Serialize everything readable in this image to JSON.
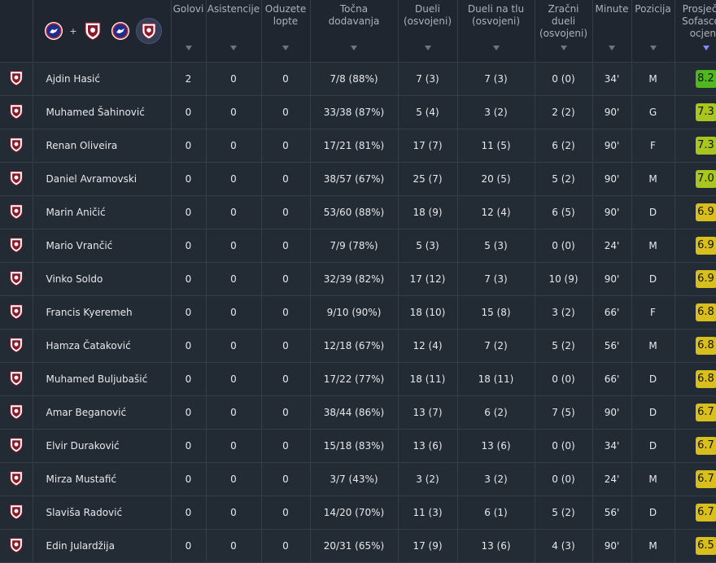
{
  "headers": {
    "goals": [
      "Golovi"
    ],
    "assists": [
      "Asistencije"
    ],
    "tackles": [
      "Oduzete",
      "lopte"
    ],
    "passes": [
      "Točna",
      "dodavanja"
    ],
    "duels": [
      "Dueli",
      "(osvojeni)"
    ],
    "ground": [
      "Dueli na tlu",
      "(osvojeni)"
    ],
    "aerial": [
      "Zračni",
      "dueli",
      "(osvojeni)"
    ],
    "minutes": [
      "Minute"
    ],
    "position": [
      "Pozicija"
    ],
    "rating": [
      "Prosječna",
      "Sofascore",
      "ocjena"
    ]
  },
  "icons": {
    "team_a": "team-a-crest-icon",
    "team_b": "team-b-crest-icon",
    "plus": "+",
    "player_shield": "club-shield-icon"
  },
  "colors": {
    "bg": "#1e252e",
    "row": "#232b34",
    "border": "#343d48",
    "rating_green": "#4fb81e",
    "rating_lime": "#a9c51f",
    "rating_yellow": "#d9bf1e",
    "sort_active": "#7f8cff"
  },
  "players": [
    {
      "name": "Ajdin Hasić",
      "goals": "2",
      "assists": "0",
      "tackles": "0",
      "passes": "7/8 (88%)",
      "duels": "7 (3)",
      "ground": "7 (3)",
      "aerial": "0 (0)",
      "minutes": "34'",
      "position": "M",
      "rating": "8.2",
      "rating_color": "#4fb81e"
    },
    {
      "name": "Muhamed Šahinović",
      "goals": "0",
      "assists": "0",
      "tackles": "0",
      "passes": "33/38 (87%)",
      "duels": "5 (4)",
      "ground": "3 (2)",
      "aerial": "2 (2)",
      "minutes": "90'",
      "position": "G",
      "rating": "7.3",
      "rating_color": "#a9c51f"
    },
    {
      "name": "Renan Oliveira",
      "goals": "0",
      "assists": "0",
      "tackles": "0",
      "passes": "17/21 (81%)",
      "duels": "17 (7)",
      "ground": "11 (5)",
      "aerial": "6 (2)",
      "minutes": "90'",
      "position": "F",
      "rating": "7.3",
      "rating_color": "#a9c51f"
    },
    {
      "name": "Daniel Avramovski",
      "goals": "0",
      "assists": "0",
      "tackles": "0",
      "passes": "38/57 (67%)",
      "duels": "25 (7)",
      "ground": "20 (5)",
      "aerial": "5 (2)",
      "minutes": "90'",
      "position": "M",
      "rating": "7.0",
      "rating_color": "#a9c51f"
    },
    {
      "name": "Marin Aničić",
      "goals": "0",
      "assists": "0",
      "tackles": "0",
      "passes": "53/60 (88%)",
      "duels": "18 (9)",
      "ground": "12 (4)",
      "aerial": "6 (5)",
      "minutes": "90'",
      "position": "D",
      "rating": "6.9",
      "rating_color": "#d9bf1e"
    },
    {
      "name": "Mario Vrančić",
      "goals": "0",
      "assists": "0",
      "tackles": "0",
      "passes": "7/9 (78%)",
      "duels": "5 (3)",
      "ground": "5 (3)",
      "aerial": "0 (0)",
      "minutes": "24'",
      "position": "M",
      "rating": "6.9",
      "rating_color": "#d9bf1e"
    },
    {
      "name": "Vinko Soldo",
      "goals": "0",
      "assists": "0",
      "tackles": "0",
      "passes": "32/39 (82%)",
      "duels": "17 (12)",
      "ground": "7 (3)",
      "aerial": "10 (9)",
      "minutes": "90'",
      "position": "D",
      "rating": "6.9",
      "rating_color": "#d9bf1e"
    },
    {
      "name": "Francis Kyeremeh",
      "goals": "0",
      "assists": "0",
      "tackles": "0",
      "passes": "9/10 (90%)",
      "duels": "18 (10)",
      "ground": "15 (8)",
      "aerial": "3 (2)",
      "minutes": "66'",
      "position": "F",
      "rating": "6.8",
      "rating_color": "#d9bf1e"
    },
    {
      "name": "Hamza Čataković",
      "goals": "0",
      "assists": "0",
      "tackles": "0",
      "passes": "12/18 (67%)",
      "duels": "12 (4)",
      "ground": "7 (2)",
      "aerial": "5 (2)",
      "minutes": "56'",
      "position": "M",
      "rating": "6.8",
      "rating_color": "#d9bf1e"
    },
    {
      "name": "Muhamed Buljubašić",
      "goals": "0",
      "assists": "0",
      "tackles": "0",
      "passes": "17/22 (77%)",
      "duels": "18 (11)",
      "ground": "18 (11)",
      "aerial": "0 (0)",
      "minutes": "66'",
      "position": "D",
      "rating": "6.8",
      "rating_color": "#d9bf1e"
    },
    {
      "name": "Amar Beganović",
      "goals": "0",
      "assists": "0",
      "tackles": "0",
      "passes": "38/44 (86%)",
      "duels": "13 (7)",
      "ground": "6 (2)",
      "aerial": "7 (5)",
      "minutes": "90'",
      "position": "D",
      "rating": "6.7",
      "rating_color": "#d9bf1e"
    },
    {
      "name": "Elvir Duraković",
      "goals": "0",
      "assists": "0",
      "tackles": "0",
      "passes": "15/18 (83%)",
      "duels": "13 (6)",
      "ground": "13 (6)",
      "aerial": "0 (0)",
      "minutes": "34'",
      "position": "D",
      "rating": "6.7",
      "rating_color": "#d9bf1e"
    },
    {
      "name": "Mirza Mustafić",
      "goals": "0",
      "assists": "0",
      "tackles": "0",
      "passes": "3/7 (43%)",
      "duels": "3 (2)",
      "ground": "3 (2)",
      "aerial": "0 (0)",
      "minutes": "24'",
      "position": "M",
      "rating": "6.7",
      "rating_color": "#d9bf1e"
    },
    {
      "name": "Slaviša Radović",
      "goals": "0",
      "assists": "0",
      "tackles": "0",
      "passes": "14/20 (70%)",
      "duels": "11 (3)",
      "ground": "6 (1)",
      "aerial": "5 (2)",
      "minutes": "56'",
      "position": "D",
      "rating": "6.7",
      "rating_color": "#d9bf1e"
    },
    {
      "name": "Edin Julardžija",
      "goals": "0",
      "assists": "0",
      "tackles": "0",
      "passes": "20/31 (65%)",
      "duels": "17 (9)",
      "ground": "13 (6)",
      "aerial": "4 (3)",
      "minutes": "90'",
      "position": "M",
      "rating": "6.5",
      "rating_color": "#d9bf1e"
    }
  ]
}
